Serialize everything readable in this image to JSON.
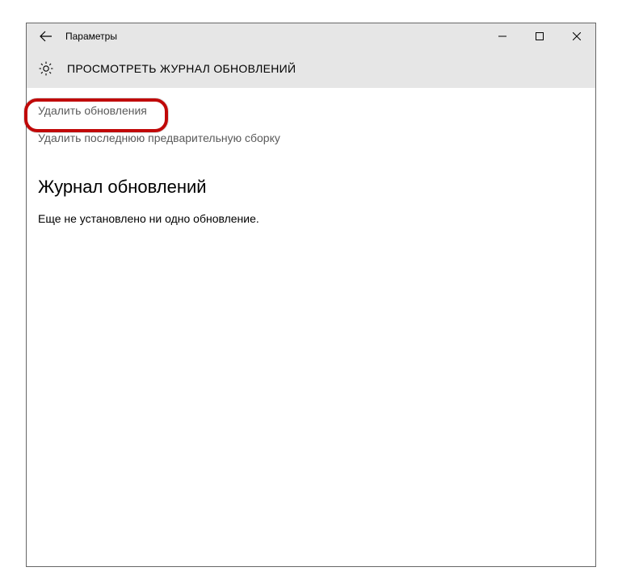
{
  "titlebar": {
    "title": "Параметры"
  },
  "header": {
    "page_title": "ПРОСМОТРЕТЬ ЖУРНАЛ ОБНОВЛЕНИЙ"
  },
  "links": {
    "uninstall_updates": "Удалить обновления",
    "uninstall_preview": "Удалить последнюю предварительную сборку"
  },
  "section": {
    "heading": "Журнал обновлений",
    "empty_message": "Еще не установлено ни одно обновление."
  }
}
